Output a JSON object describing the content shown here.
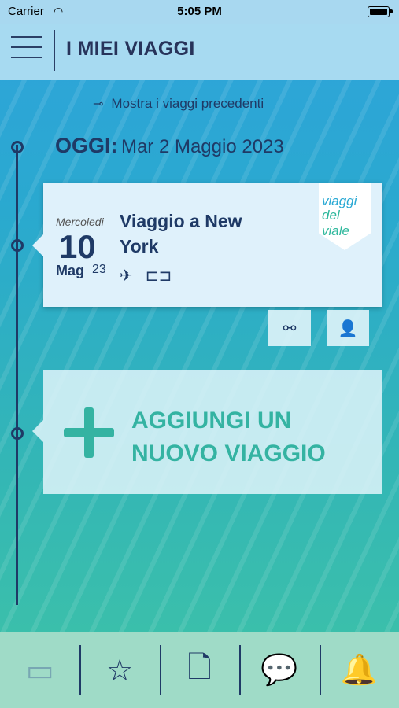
{
  "status": {
    "carrier": "Carrier",
    "time": "5:05 PM"
  },
  "header": {
    "title": "I MIEI VIAGGI"
  },
  "timeline": {
    "show_previous": "Mostra i viaggi precedenti",
    "today_label": "OGGI:",
    "today_date": "Mar 2 Maggio 2023"
  },
  "trip": {
    "day_name": "Mercoledi",
    "day_number": "10",
    "month": "Mag",
    "year": "23",
    "title": "Viaggio a New York",
    "brand_line1": "viaggi",
    "brand_line2": "del viale",
    "icons": [
      "plane-icon",
      "bed-icon"
    ]
  },
  "actions": {
    "share_icon": "share-icon",
    "add_participant_icon": "add-user-icon"
  },
  "add_trip": {
    "label_line1": "AGGIUNGI UN",
    "label_line2": "NUOVO VIAGGIO"
  },
  "tabbar": [
    "calendar-icon",
    "star-icon",
    "add-document-icon",
    "chat-icon",
    "bell-icon"
  ]
}
